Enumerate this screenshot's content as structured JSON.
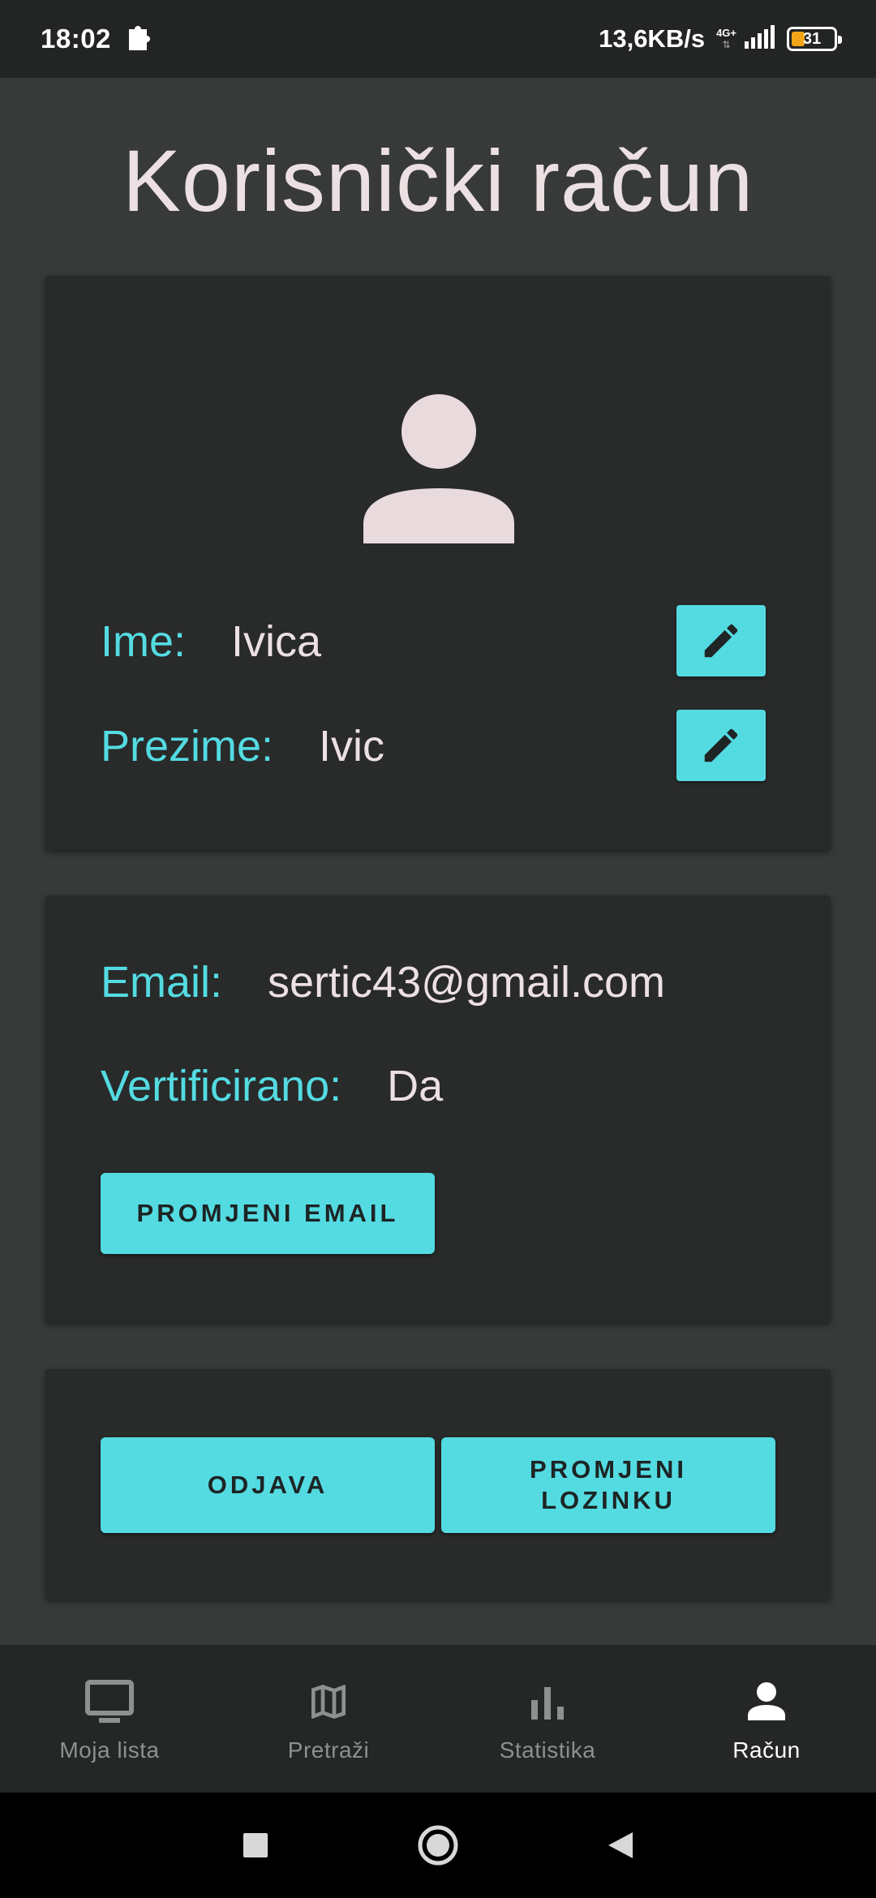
{
  "status_bar": {
    "time": "18:02",
    "speed": "13,6KB/s",
    "network": "4G+",
    "battery": "31"
  },
  "page": {
    "title": "Korisnički račun"
  },
  "profile": {
    "first_name_label": "Ime:",
    "first_name_value": "Ivica",
    "last_name_label": "Prezime:",
    "last_name_value": "Ivic"
  },
  "account": {
    "email_label": "Email:",
    "email_value": "sertic43@gmail.com",
    "verified_label": "Vertificirano:",
    "verified_value": "Da",
    "change_email_button": "PROMJENI EMAIL"
  },
  "actions": {
    "logout_button": "ODJAVA",
    "change_password_line1": "PROMJENI",
    "change_password_line2": "LOZINKU"
  },
  "bottom_nav": {
    "items": [
      {
        "label": "Moja lista",
        "icon": "monitor-icon"
      },
      {
        "label": "Pretraži",
        "icon": "map-icon"
      },
      {
        "label": "Statistika",
        "icon": "bar-chart-icon"
      },
      {
        "label": "Račun",
        "icon": "person-icon"
      }
    ],
    "active_index": 3
  },
  "colors": {
    "accent": "#54dbe2",
    "background": "#373a39",
    "card": "#292a2a",
    "text": "#ece0e2"
  }
}
